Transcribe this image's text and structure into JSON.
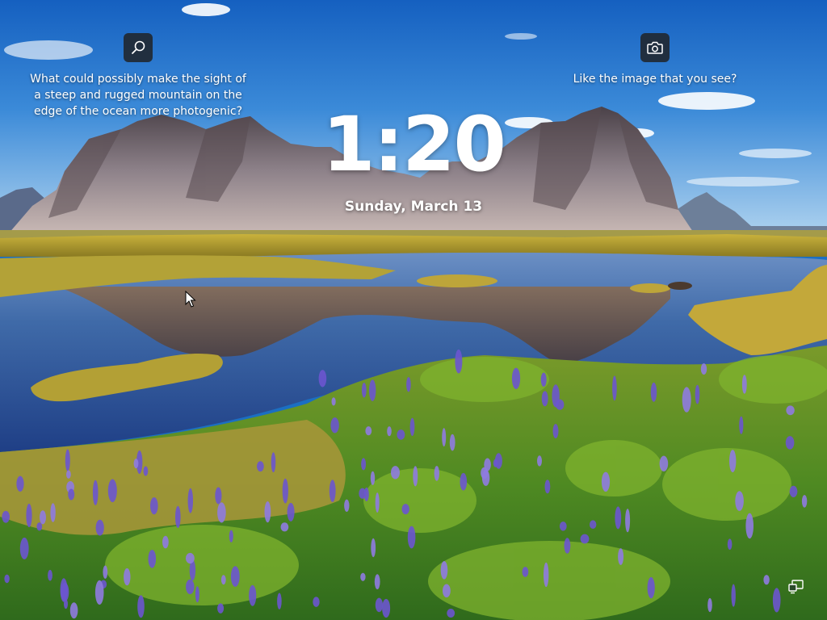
{
  "spotlight": {
    "search_icon": "search-icon",
    "camera_icon": "camera-icon",
    "search_caption": "What could possibly make the sight of a steep and rugged mountain on the edge of the ocean more photogenic?",
    "camera_caption": "Like the image that you see?"
  },
  "clock": {
    "time": "1:20",
    "date": "Sunday, March 13"
  },
  "status": {
    "network_icon": "network-icon"
  },
  "colors": {
    "sky_top": "#1a67c4",
    "sky_bottom": "#a9d0ef",
    "water": "#2a5ea8",
    "grass": "#b7a431",
    "lupine": "#6a52c9",
    "text": "#ffffff"
  }
}
